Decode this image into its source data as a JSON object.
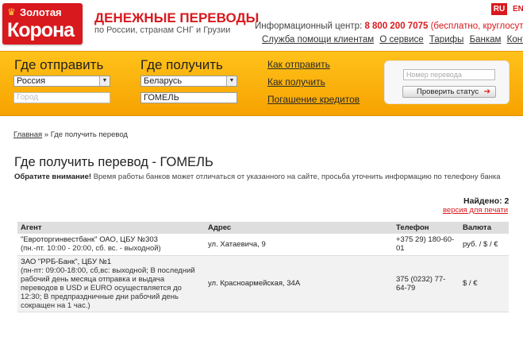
{
  "header": {
    "logo_line1": "Золотая",
    "logo_line2": "Корона",
    "brand_title": "ДЕНЕЖНЫЕ ПЕРЕВОДЫ",
    "brand_subtitle": "по России, странам СНГ и Грузии",
    "info_label": "Информационный центр:",
    "info_phone": "8 800 200 7075",
    "info_note": "(бесплатно, круглосуточно)",
    "lang_ru": "RU",
    "lang_en": "EN",
    "nav": [
      "Служба помощи клиентам",
      "О сервисе",
      "Тарифы",
      "Банкам",
      "Контакты"
    ]
  },
  "search": {
    "from_title": "Где отправить",
    "from_country": "Россия",
    "from_city_placeholder": "Город",
    "to_title": "Где получить",
    "to_country": "Беларусь",
    "to_city": "ГОМЕЛЬ",
    "links": [
      "Как отправить",
      "Как получить",
      "Погашение кредитов"
    ],
    "status_placeholder": "Номер перевода",
    "status_button": "Проверить статус"
  },
  "content": {
    "breadcrumb_home": "Главная",
    "breadcrumb_current": "Где получить перевод",
    "breadcrumb_sep": " » ",
    "title": "Где получить перевод - ГОМЕЛЬ",
    "notice_label": "Обратите внимание!",
    "notice_text": "Время работы банков может отличаться от указанного на сайте, просьба уточнить информацию по телефону банка",
    "found": "Найдено: 2",
    "print_link": "версия для печати"
  },
  "table": {
    "headers": [
      "Агент",
      "Адрес",
      "Телефон",
      "Валюта"
    ],
    "rows": [
      {
        "agent": "\"Евроторгинвестбанк\" ОАО, ЦБУ №303",
        "hours": "(пн.-пт. 10:00 - 20:00, сб. вс. - выходной)",
        "address": "ул. Хатаевича, 9",
        "phone": "+375 29) 180-60-01",
        "currency": "руб. / $ / €"
      },
      {
        "agent": "ЗАО \"РРБ-Банк\", ЦБУ №1",
        "hours": "(пн-пт: 09:00-18:00, сб,вс: выходной; В последний рабочий день месяца отправка и выдача переводов в USD и EURO осуществляется до 12:30; В предпраздничные дни рабочий день сокращен на 1 час.)",
        "address": "ул. Красноармейская, 34А",
        "phone": "375 (0232) 77-64-79",
        "currency": "$ / €"
      }
    ]
  },
  "colors": {
    "brand_red": "#d8191e",
    "band_orange": "#f7a200"
  }
}
